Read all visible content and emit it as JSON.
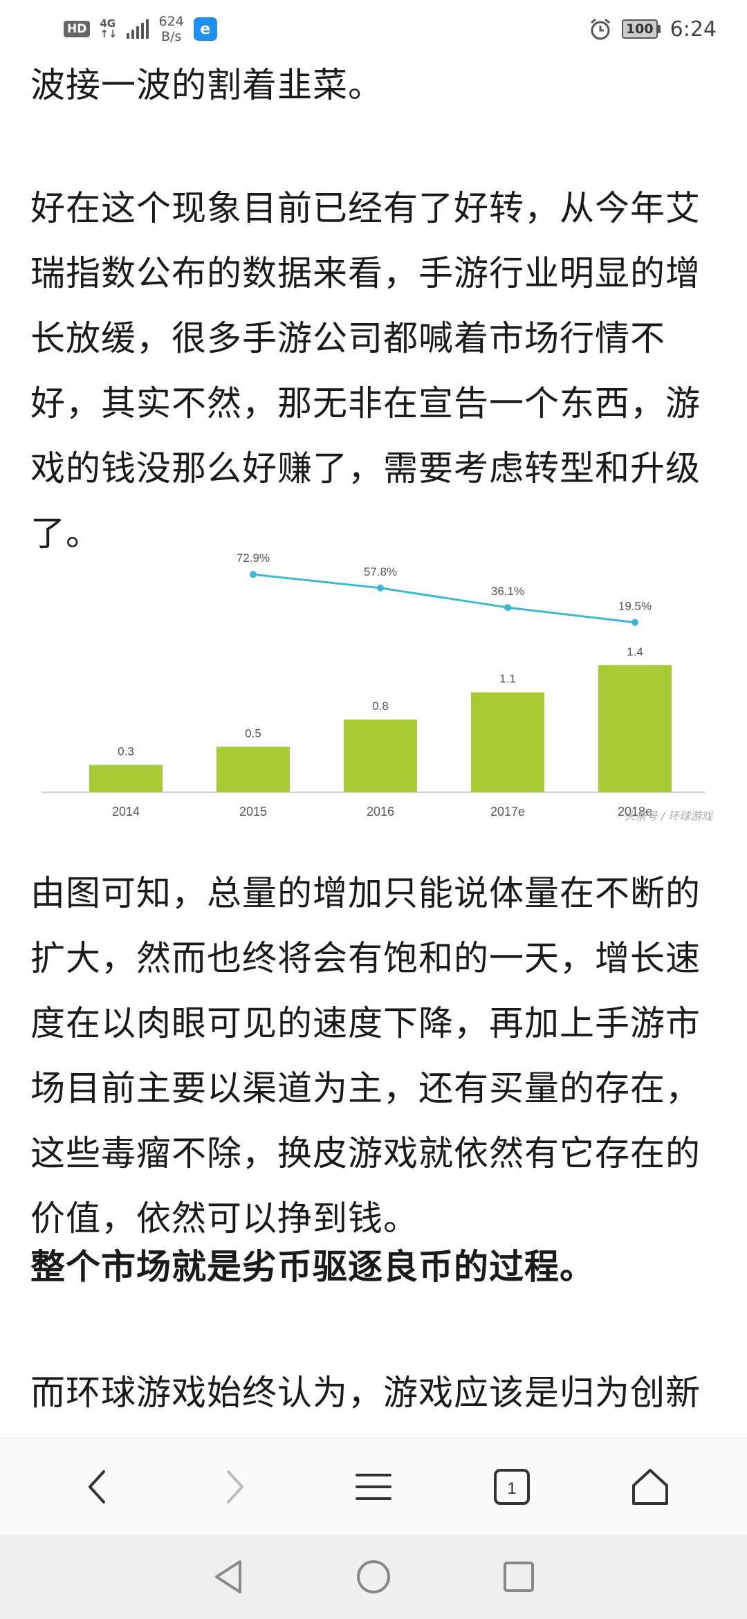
{
  "status_bar": {
    "hd": "HD",
    "network_type": "4G",
    "network_sub": "↑↓",
    "speed_value": "624",
    "speed_unit": "B/s",
    "app_icon": "e",
    "battery": "100",
    "time": "6:24"
  },
  "article": {
    "p1": "波接一波的割着韭菜。",
    "p2": "好在这个现象目前已经有了好转，从今年艾瑞指数公布的数据来看，手游行业明显的增长放缓，很多手游公司都喊着市场行情不好，其实不然，那无非在宣告一个东西，游戏的钱没那么好赚了，需要考虑转型和升级了。",
    "p3": "由图可知，总量的增加只能说体量在不断的扩大，然而也终将会有饱和的一天，增长速度在以肉眼可见的速度下降，再加上手游市场目前主要以渠道为主，还有买量的存在，这些毒瘤不除，换皮游戏就依然有它存在的价值，依然可以挣到钱。",
    "p4": "整个市场就是劣币驱逐良币的过程。",
    "p5": "而环球游戏始终认为，游戏应该是归为创新型产业而非工厂化，诚然，创意对于游"
  },
  "chart_data": {
    "type": "bar",
    "categories": [
      "2014",
      "2015",
      "2016",
      "2017e",
      "2018e"
    ],
    "values": [
      0.3,
      0.5,
      0.8,
      1.1,
      1.4
    ],
    "value_labels": [
      "0.3",
      "0.5",
      "0.8",
      "1.1",
      "1.4"
    ],
    "line": {
      "x": [
        "2015",
        "2016",
        "2017e",
        "2018e"
      ],
      "values": [
        72.9,
        57.8,
        36.1,
        19.5
      ],
      "labels": [
        "72.9%",
        "57.8%",
        "36.1%",
        "19.5%"
      ]
    },
    "watermark": "头条号 / 环球游戏",
    "bar_color": "#a6cb35",
    "line_color": "#3bb8d6",
    "ylim": [
      0,
      1.6
    ],
    "line_ylim": [
      0,
      100
    ]
  },
  "toolbar": {
    "back_icon": "chevron-left-icon",
    "forward_icon": "chevron-right-icon",
    "menu_icon": "menu-icon",
    "tabs_count": "1",
    "home_icon": "home-icon"
  },
  "navbar": {
    "back_icon": "triangle-back-icon",
    "home_icon": "circle-home-icon",
    "recents_icon": "square-recents-icon"
  }
}
